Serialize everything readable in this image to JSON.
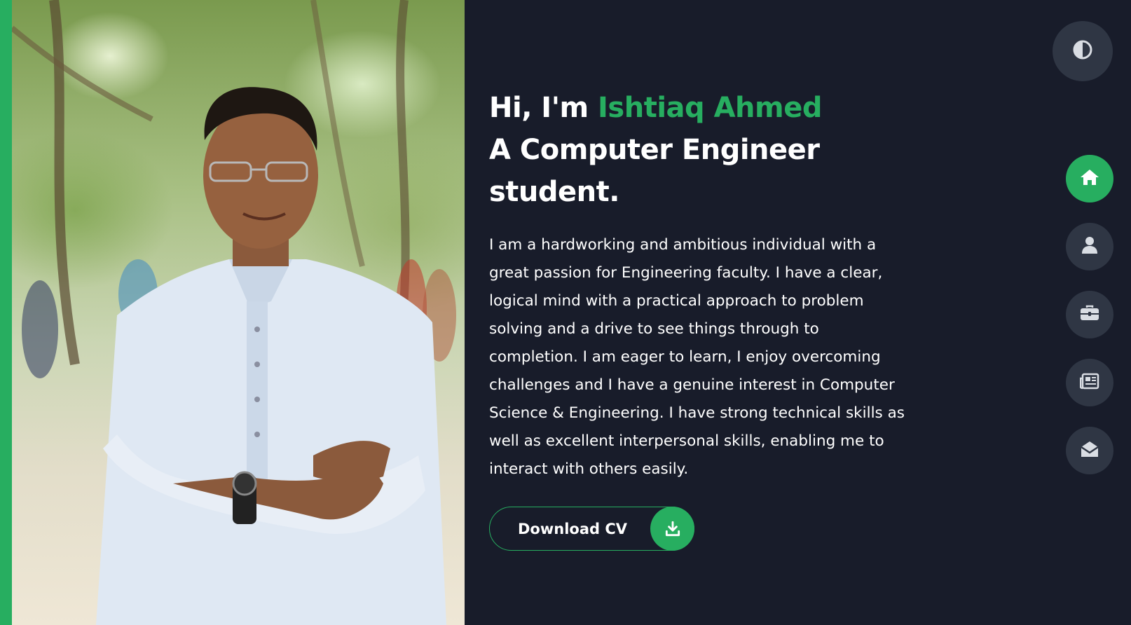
{
  "hero": {
    "greeting": "Hi, I'm ",
    "name": "Ishtiaq Ahmed",
    "title_line1": "A Computer Engineer",
    "title_line2": "student.",
    "bio": "I am a hardworking and ambitious individual with a great passion for Engineering faculty. I have a clear, logical mind with a practical approach to problem solving and a drive to see things through to completion. I am eager to learn, I enjoy overcoming challenges and I have a genuine interest in Computer Science & Engineering. I have strong technical skills as well as excellent interpersonal skills, enabling me to interact with others easily.",
    "download_label": "Download CV"
  },
  "icons": {
    "theme": "half-circle-icon",
    "download": "download-icon",
    "nav": [
      "home-icon",
      "user-icon",
      "briefcase-icon",
      "newspaper-icon",
      "envelope-open-icon"
    ]
  },
  "colors": {
    "background": "#181c2a",
    "accent": "#27ae60",
    "nav_button": "#2f3644",
    "text": "#ffffff"
  },
  "nav": {
    "active_index": 0
  }
}
